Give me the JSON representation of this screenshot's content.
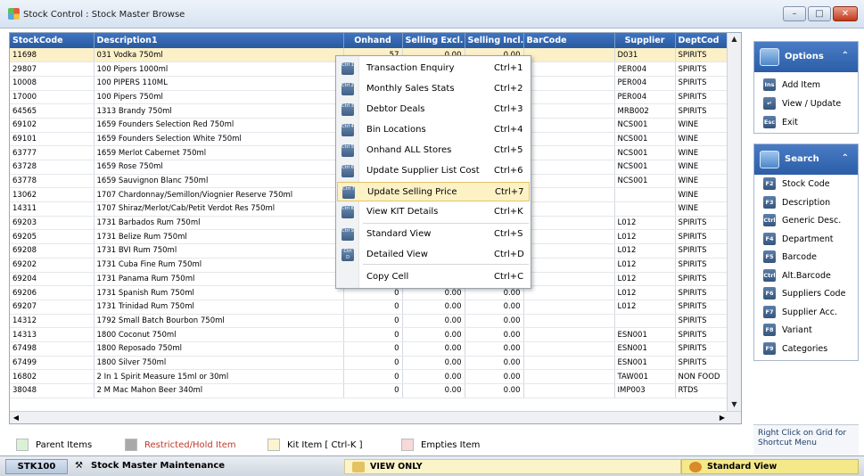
{
  "window": {
    "title": "Stock Control : Stock Master Browse",
    "controls": {
      "minimize": "–",
      "maximize": "□",
      "close": "✕"
    }
  },
  "grid": {
    "columns": [
      "StockCode",
      "Description1",
      "Onhand",
      "Selling Excl.",
      "Selling Incl.",
      "BarCode",
      "Supplier",
      "DeptCod"
    ],
    "rows": [
      [
        "11698",
        "031 Vodka 750ml",
        "57",
        "0.00",
        "0.00",
        "",
        "D031",
        "SPIRITS"
      ],
      [
        "29807",
        "100 Pipers 1000ml",
        "",
        "",
        "",
        "",
        "PER004",
        "SPIRITS"
      ],
      [
        "10008",
        "100 PIPERS 110ML",
        "",
        "",
        "",
        "",
        "PER004",
        "SPIRITS"
      ],
      [
        "17000",
        "100 Pipers 750ml",
        "",
        "",
        "",
        "",
        "PER004",
        "SPIRITS"
      ],
      [
        "64565",
        "1313 Brandy 750ml",
        "",
        "",
        "",
        "",
        "MRB002",
        "SPIRITS"
      ],
      [
        "69102",
        "1659 Founders Selection Red 750ml",
        "",
        "",
        "",
        "",
        "NCS001",
        "WINE"
      ],
      [
        "69101",
        "1659 Founders Selection White 750ml",
        "",
        "",
        "",
        "",
        "NCS001",
        "WINE"
      ],
      [
        "63777",
        "1659 Merlot Cabernet 750ml",
        "",
        "",
        "",
        "",
        "NCS001",
        "WINE"
      ],
      [
        "63728",
        "1659 Rose 750ml",
        "",
        "",
        "",
        "",
        "NCS001",
        "WINE"
      ],
      [
        "63778",
        "1659 Sauvignon Blanc 750ml",
        "",
        "",
        "",
        "",
        "NCS001",
        "WINE"
      ],
      [
        "13062",
        "1707 Chardonnay/Semillon/Viognier Reserve 750ml",
        "",
        "",
        "",
        "",
        "",
        "WINE"
      ],
      [
        "14311",
        "1707 Shiraz/Merlot/Cab/Petit Verdot Res 750ml",
        "",
        "",
        "",
        "",
        "",
        "WINE"
      ],
      [
        "69203",
        "1731 Barbados Rum 750ml",
        "",
        "",
        "",
        "",
        "L012",
        "SPIRITS"
      ],
      [
        "69205",
        "1731 Belize Rum 750ml",
        "",
        "",
        "",
        "",
        "L012",
        "SPIRITS"
      ],
      [
        "69208",
        "1731 BVI Rum 750ml",
        "",
        "",
        "",
        "",
        "L012",
        "SPIRITS"
      ],
      [
        "69202",
        "1731 Cuba Fine Rum 750ml",
        "",
        "",
        "",
        "",
        "L012",
        "SPIRITS"
      ],
      [
        "69204",
        "1731 Panama Rum 750ml",
        "0",
        "0.00",
        "0.00",
        "",
        "L012",
        "SPIRITS"
      ],
      [
        "69206",
        "1731 Spanish Rum 750ml",
        "0",
        "0.00",
        "0.00",
        "",
        "L012",
        "SPIRITS"
      ],
      [
        "69207",
        "1731 Trinidad Rum 750ml",
        "0",
        "0.00",
        "0.00",
        "",
        "L012",
        "SPIRITS"
      ],
      [
        "14312",
        "1792 Small Batch Bourbon 750ml",
        "0",
        "0.00",
        "0.00",
        "",
        "",
        "SPIRITS"
      ],
      [
        "14313",
        "1800 Coconut 750ml",
        "0",
        "0.00",
        "0.00",
        "",
        "ESN001",
        "SPIRITS"
      ],
      [
        "67498",
        "1800 Reposado 750ml",
        "0",
        "0.00",
        "0.00",
        "",
        "ESN001",
        "SPIRITS"
      ],
      [
        "67499",
        "1800 Silver 750ml",
        "0",
        "0.00",
        "0.00",
        "",
        "ESN001",
        "SPIRITS"
      ],
      [
        "16802",
        "2 In 1 Spirit Measure 15ml or 30ml",
        "0",
        "0.00",
        "0.00",
        "",
        "TAW001",
        "NON FOOD"
      ],
      [
        "38048",
        "2 M Mac Mahon Beer 340ml",
        "0",
        "0.00",
        "0.00",
        "",
        "IMP003",
        "RTDS"
      ]
    ]
  },
  "context_menu": {
    "items": [
      {
        "key": "Ctrl 1",
        "label": "Transaction Enquiry",
        "shortcut": "Ctrl+1"
      },
      {
        "key": "Ctrl 2",
        "label": "Monthly Sales Stats",
        "shortcut": "Ctrl+2"
      },
      {
        "key": "Ctrl 3",
        "label": "Debtor Deals",
        "shortcut": "Ctrl+3"
      },
      {
        "key": "Ctrl 4",
        "label": "Bin Locations",
        "shortcut": "Ctrl+4"
      },
      {
        "key": "Ctrl 5",
        "label": "Onhand ALL Stores",
        "shortcut": "Ctrl+5"
      },
      {
        "key": "Ctrl 6",
        "label": "Update Supplier List Cost",
        "shortcut": "Ctrl+6"
      },
      {
        "key": "Ctrl 7",
        "label": "Update Selling Price",
        "shortcut": "Ctrl+7"
      },
      {
        "key": "Ctrl K",
        "label": "View KIT Details",
        "shortcut": "Ctrl+K"
      },
      {
        "key": "Ctrl S",
        "label": "Standard View",
        "shortcut": "Ctrl+S"
      },
      {
        "key": "Ctrl D",
        "label": "Detailed View",
        "shortcut": "Ctrl+D"
      },
      {
        "key": "",
        "label": "Copy Cell",
        "shortcut": "Ctrl+C"
      }
    ]
  },
  "options_panel": {
    "title": "Options",
    "items": [
      {
        "key": "Ins",
        "label": "Add Item"
      },
      {
        "key": "↵",
        "label": "View / Update"
      },
      {
        "key": "Esc",
        "label": "Exit"
      }
    ]
  },
  "search_panel": {
    "title": "Search",
    "items": [
      {
        "key": "F2",
        "label": "Stock Code"
      },
      {
        "key": "F3",
        "label": "Description"
      },
      {
        "key": "Ctrl F3",
        "label": "Generic Desc."
      },
      {
        "key": "F4",
        "label": "Department"
      },
      {
        "key": "F5",
        "label": "Barcode"
      },
      {
        "key": "Ctrl F5",
        "label": "Alt.Barcode"
      },
      {
        "key": "F6",
        "label": "Suppliers Code"
      },
      {
        "key": "F7",
        "label": "Supplier Acc."
      },
      {
        "key": "F8",
        "label": "Variant"
      },
      {
        "key": "F9",
        "label": "Categories"
      }
    ]
  },
  "hint": "Right Click on Grid for Shortcut Menu",
  "legend": {
    "items": [
      {
        "label": "Parent Items",
        "color": "#d9f2d4"
      },
      {
        "label": "Restricted/Hold Item",
        "color": "#a9a9a9",
        "text_color": "#c0392b"
      },
      {
        "label": "Kit Item [ Ctrl-K ]",
        "color": "#fbf4cf"
      },
      {
        "label": "Empties Item",
        "color": "#f7d9d9"
      }
    ]
  },
  "status": {
    "code": "STK100",
    "module": "Stock Master Maintenance",
    "mode": "VIEW ONLY",
    "view": "Standard View"
  }
}
